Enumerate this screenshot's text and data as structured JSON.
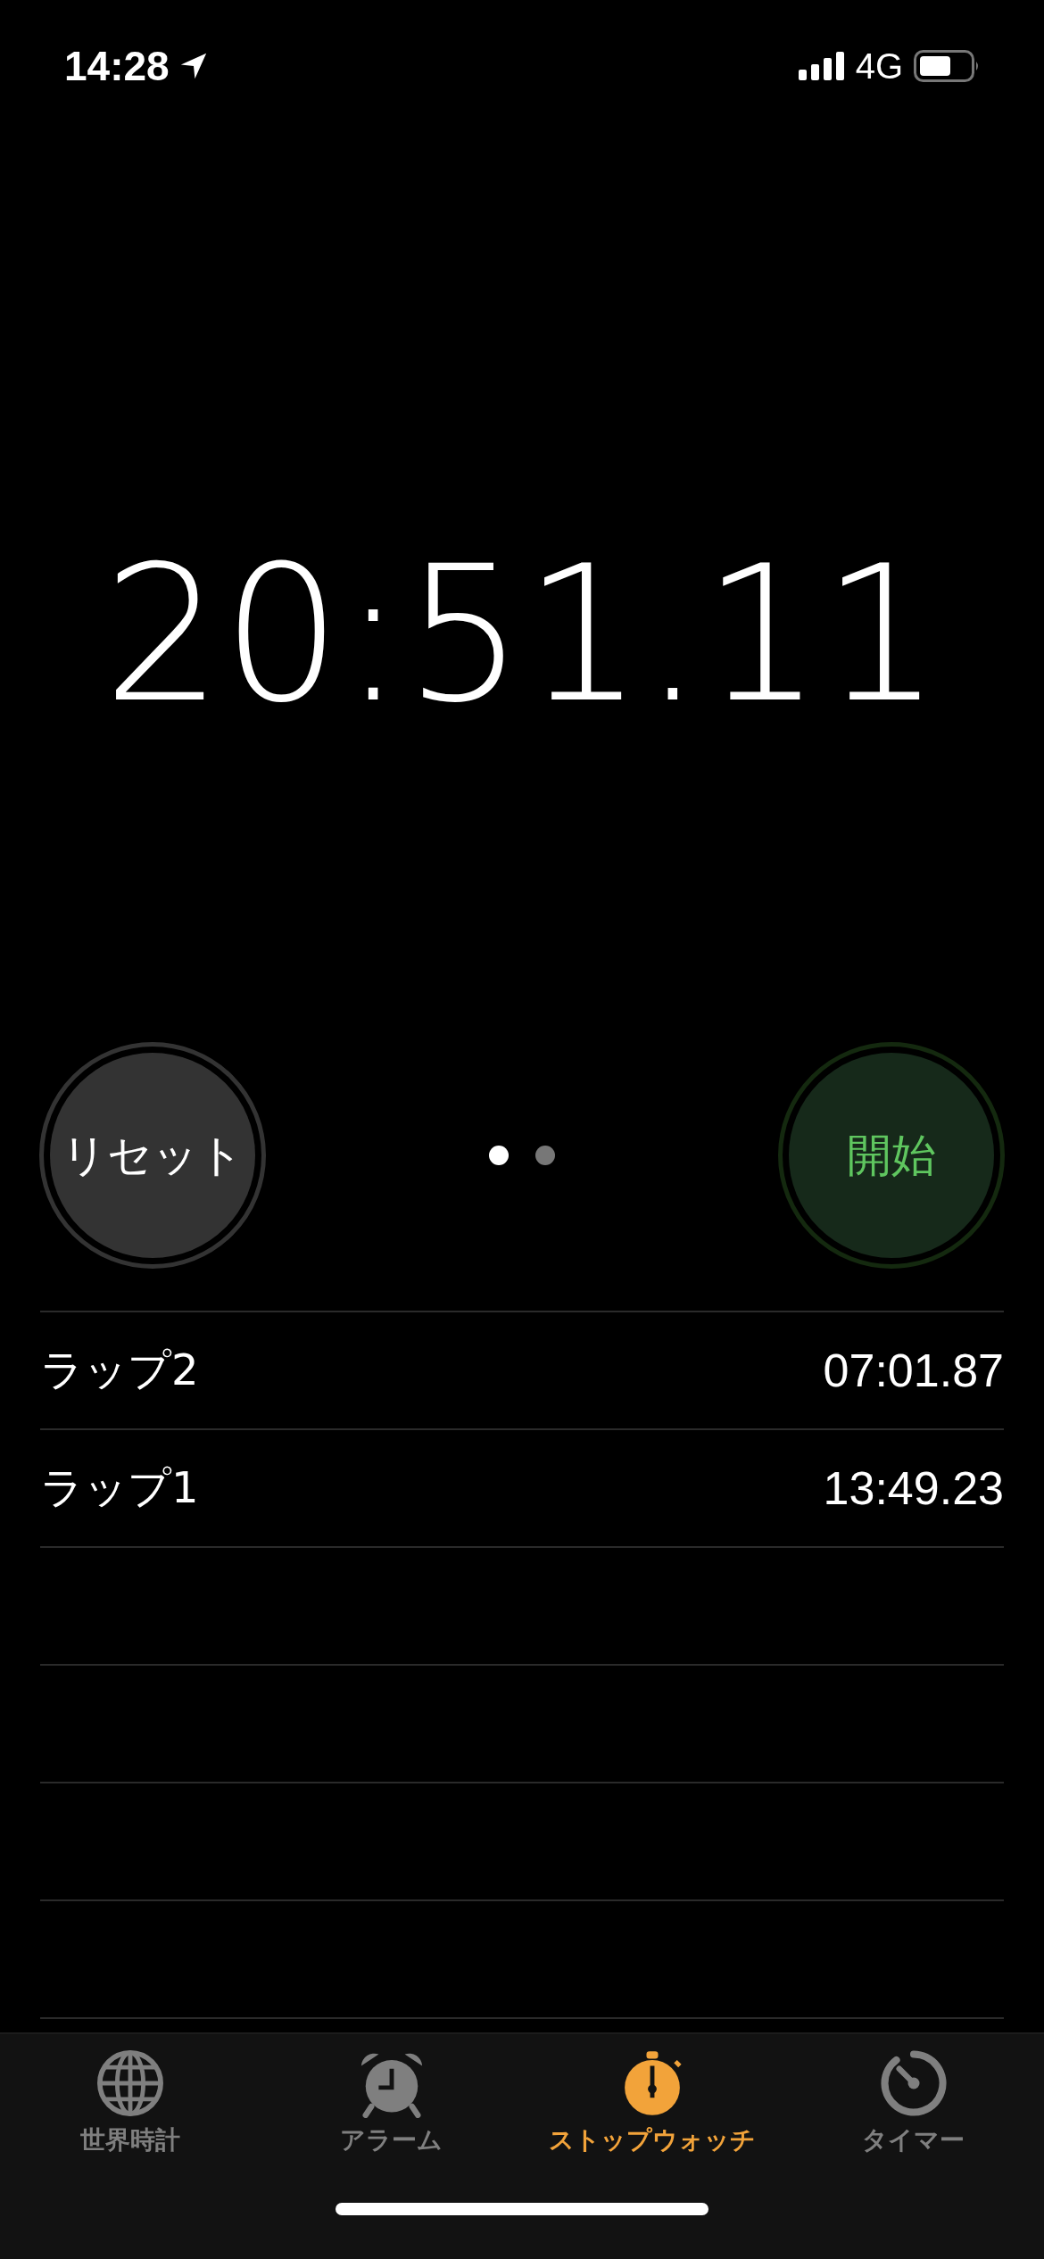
{
  "status_bar": {
    "time": "14:28",
    "network": "4G"
  },
  "stopwatch": {
    "time": "20:51.11"
  },
  "buttons": [
    {
      "kind": "reset",
      "label": "リセット"
    },
    {
      "kind": "start",
      "label": "開始"
    }
  ],
  "page_dots": [
    {
      "selected": true
    },
    {
      "selected": false
    }
  ],
  "laps": [
    {
      "label": "ラップ2",
      "time": "07:01.87"
    },
    {
      "label": "ラップ1",
      "time": "13:49.23"
    }
  ],
  "tabs": [
    {
      "kind": "globe",
      "label": "世界時計",
      "selected": false
    },
    {
      "kind": "alarm",
      "label": "アラーム",
      "selected": false
    },
    {
      "kind": "stopwatch",
      "label": "ストップウォッチ",
      "selected": true
    },
    {
      "kind": "timer",
      "label": "タイマー",
      "selected": false
    }
  ]
}
